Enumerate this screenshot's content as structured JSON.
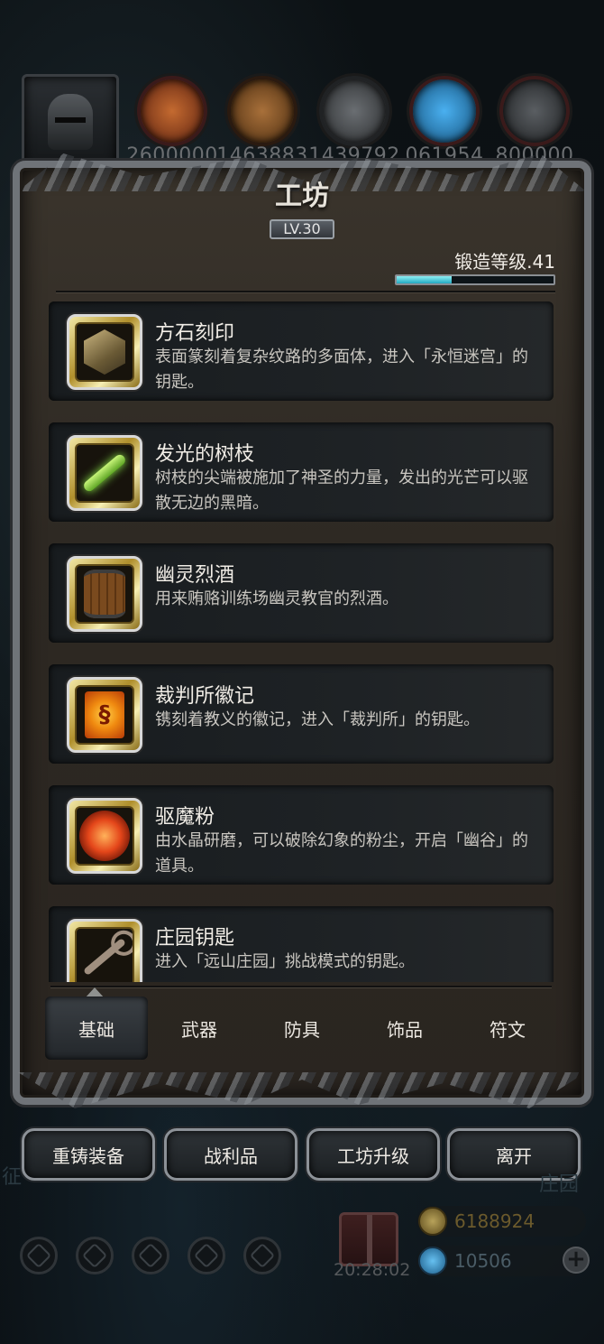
{
  "top_resources": {
    "values": [
      "2600000",
      "1463883",
      "1439792",
      "061954",
      "800000"
    ],
    "colors": [
      "#a04020",
      "#8a5a2a",
      "#555a5e",
      "#2a7fc0",
      "#4a4f54"
    ]
  },
  "panel": {
    "title": "工坊",
    "level": "LV.30",
    "forge_level_label": "锻造等级.41",
    "forge_progress": 0.35
  },
  "items": [
    {
      "name": "方石刻印",
      "desc": "表面篆刻着复杂纹路的多面体，进入「永恒迷宫」的钥匙。",
      "icon": "stone-seal-icon"
    },
    {
      "name": "发光的树枝",
      "desc": "树枝的尖端被施加了神圣的力量，发出的光芒可以驱散无边的黑暗。",
      "icon": "glowing-branch-icon"
    },
    {
      "name": "幽灵烈酒",
      "desc": "用来贿赂训练场幽灵教官的烈酒。",
      "icon": "barrel-icon"
    },
    {
      "name": "裁判所徽记",
      "desc": "镌刻着教义的徽记，进入「裁判所」的钥匙。",
      "icon": "emblem-icon"
    },
    {
      "name": "驱魔粉",
      "desc": "由水晶研磨，可以破除幻象的粉尘，开启「幽谷」的道具。",
      "icon": "powder-icon"
    },
    {
      "name": "庄园钥匙",
      "desc": "进入「远山庄园」挑战模式的钥匙。",
      "icon": "key-icon"
    }
  ],
  "tabs": [
    "基础",
    "武器",
    "防具",
    "饰品",
    "符文"
  ],
  "active_tab": "基础",
  "actions": [
    "重铸装备",
    "战利品",
    "工坊升级",
    "离开"
  ],
  "hud": {
    "left_text": "征",
    "right_text": "庄园",
    "clock": "20:28:02",
    "gold": "6188924",
    "gems": "10506",
    "plus": "+"
  }
}
